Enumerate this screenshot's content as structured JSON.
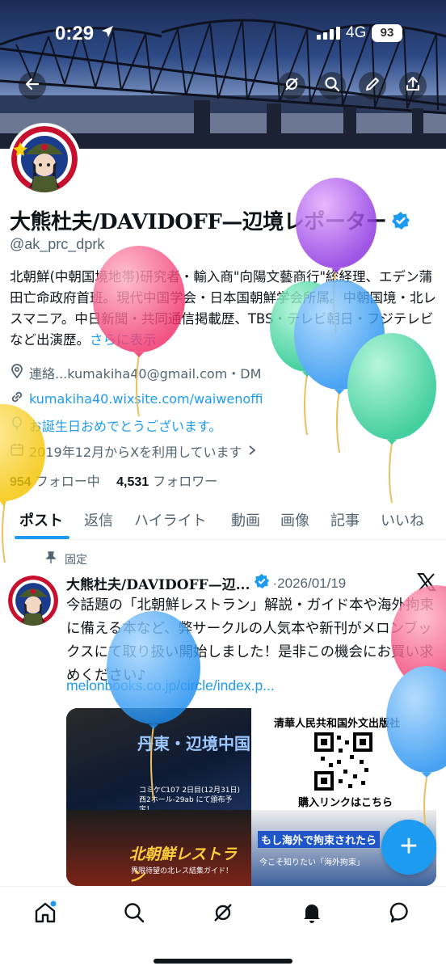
{
  "status_bar": {
    "time": "0:29",
    "network": "4G",
    "battery": "93"
  },
  "profile": {
    "display_name": "大熊杜夫/DAVIDOFF—辺境レポーター",
    "handle": "@ak_prc_dprk",
    "bio": "北朝鮮(中朝国境地帯)研究者・輸入商\"向陽文藝商行\"総経理、エデン蒲田亡命政府首班。現代中国学会・日本国朝鮮学会所属。中朝国境・北レスマニア。中日新聞・共同通信掲載歴、TBS・テレビ朝日・フジテレビなど出演歴。",
    "bio_more": "さらに表示",
    "contact": "連絡...kumakiha40@gmail.com・DM",
    "website": "kumakiha40.wixsite.com/waiwenoffi",
    "birthday": "お誕生日おめでとうございます。",
    "joined": "2019年12月からXを利用しています",
    "following_count": "954",
    "following_label": "フォロー中",
    "followers_count": "4,531",
    "followers_label": "フォロワー"
  },
  "tabs": [
    "ポスト",
    "返信",
    "ハイライト",
    "動画",
    "画像",
    "記事",
    "いいね"
  ],
  "pinned_post": {
    "pinned_label": "固定",
    "author": "大熊杜夫/DAVIDOFF—辺...",
    "date": "·2026/01/19",
    "text": "今話題の「北朝鮮レストラン」解説・ガイド本や海外拘束に備える本など、弊サークルの人気本や新刊がメロンブックスにて取り扱い開始しました！是非この機会にお買い求めください♪",
    "link": "melonbooks.co.jp/circle/index.p...",
    "media": {
      "tl_title": "丹東・辺境中国",
      "tl_note": "コミケC107 2日目(12月31日)西2ホール-29ab にて頒布予定！",
      "tr_title": "清華人民共和国外文出版社",
      "tr_link": "購入リンクはこちら",
      "bl_title": "北朝鮮レストラン",
      "bl_sub": "界限待望の北レス結集ガイド！",
      "br_title": "もし海外で拘束されたら",
      "br_sub": "今こそ知りたい「海外拘束」"
    }
  },
  "icons": {
    "back": "back-arrow-icon",
    "grok": "grok-icon",
    "search": "search-icon",
    "edit": "edit-pen-icon",
    "share": "share-icon",
    "compose": "compose-plus-icon"
  },
  "colors": {
    "accent": "#1d9bf0",
    "text": "#0f1419",
    "muted": "#536471"
  }
}
